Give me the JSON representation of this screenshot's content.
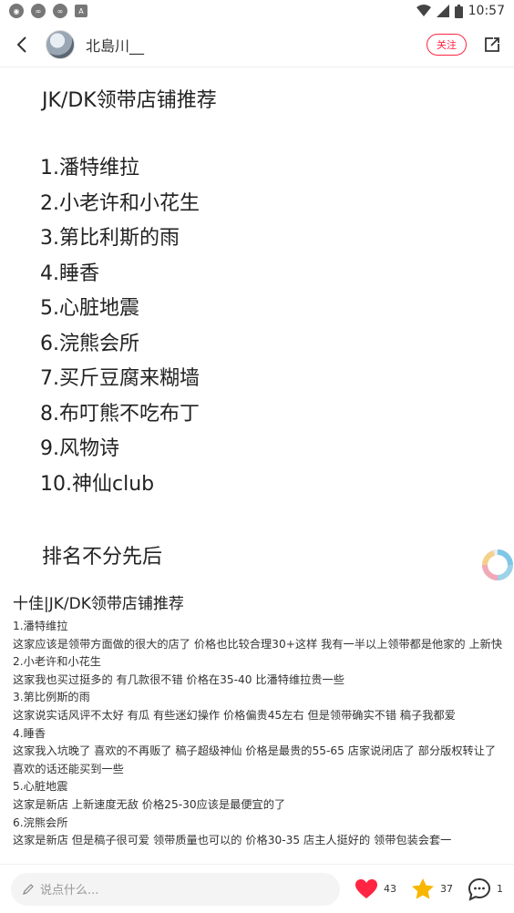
{
  "status": {
    "time": "10:57"
  },
  "header": {
    "username": "北島川__",
    "follow_label": "关注"
  },
  "image": {
    "title": "JK/DK领带店铺推荐",
    "list": [
      "1.潘特维拉",
      "2.小老许和小花生",
      "3.第比利斯的雨",
      "4.睡香",
      "5.心脏地震",
      "6.浣熊会所",
      "7.买斤豆腐来糊墙",
      "8.布叮熊不吃布丁",
      "9.风物诗",
      "10.神仙club"
    ],
    "footer": "排名不分先后"
  },
  "post": {
    "title": "十佳|JK/DK领带店铺推荐",
    "lines": [
      "1.潘特维拉",
      "这家应该是领带方面做的很大的店了 价格也比较合理30+这样  我有一半以上领带都是他家的 上新快",
      "2.小老许和小花生",
      "这家我也买过挺多的 有几款很不错 价格在35-40 比潘特维拉贵一些",
      "3.第比例斯的雨",
      "这家说实话风评不太好 有瓜 有些迷幻操作 价格偏贵45左右 但是领带确实不错 稿子我都爱",
      "4.睡香",
      "这家我入坑晚了 喜欢的不再贩了 稿子超级神仙 价格是最贵的55-65 店家说闭店了 部分版权转让了 喜欢的话还能买到一些",
      "5.心脏地震",
      "这家是新店 上新速度无敌 价格25-30应该是最便宜的了",
      "6.浣熊会所",
      "这家是新店 但是稿子很可爱 领带质量也可以的 价格30-35 店主人挺好的 领带包装会套一"
    ]
  },
  "bottom": {
    "comment_placeholder": "说点什么...",
    "likes": "43",
    "stars": "37",
    "comments": "1"
  },
  "colors": {
    "accent": "#ff2442",
    "star": "#f9b600"
  }
}
